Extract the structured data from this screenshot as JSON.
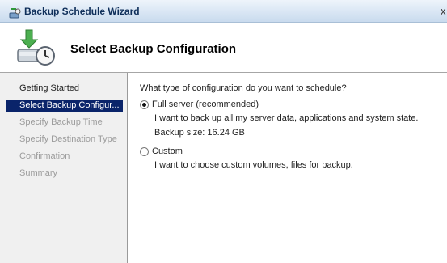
{
  "window": {
    "title": "Backup Schedule Wizard",
    "close_glyph": "x"
  },
  "header": {
    "title": "Select Backup Configuration",
    "icon": "backup-schedule-icon"
  },
  "nav": {
    "items": [
      {
        "label": "Getting Started",
        "state": "visited"
      },
      {
        "label": "Select Backup Configur...",
        "state": "selected"
      },
      {
        "label": "Specify Backup Time",
        "state": "pending"
      },
      {
        "label": "Specify Destination Type",
        "state": "pending"
      },
      {
        "label": "Confirmation",
        "state": "pending"
      },
      {
        "label": "Summary",
        "state": "pending"
      }
    ]
  },
  "content": {
    "question": "What type of configuration do you want to schedule?",
    "options": [
      {
        "label": "Full server (recommended)",
        "checked": true,
        "description": "I want to back up all my server data, applications and system state.",
        "detail": "Backup size: 16.24 GB"
      },
      {
        "label": "Custom",
        "checked": false,
        "description": "I want to choose custom volumes, files for backup."
      }
    ]
  },
  "colors": {
    "selection": "#0a246a",
    "nav_background": "#f0f0f0",
    "title_text": "#0f2f5a"
  }
}
